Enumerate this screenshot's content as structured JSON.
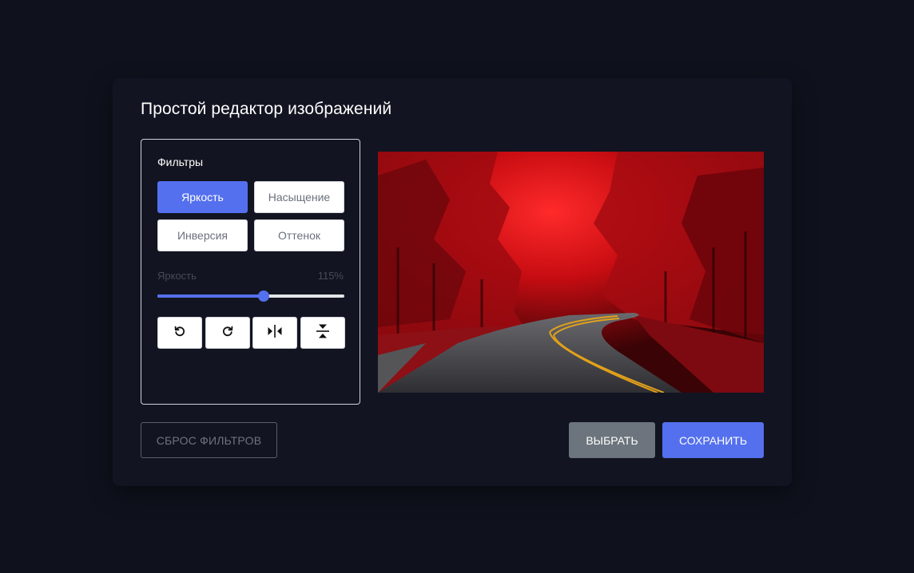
{
  "app": {
    "title": "Простой редактор изображений"
  },
  "filters": {
    "label": "Фильтры",
    "buttons": [
      {
        "label": "Яркость",
        "active": true
      },
      {
        "label": "Насыщение",
        "active": false
      },
      {
        "label": "Инверсия",
        "active": false
      },
      {
        "label": "Оттенок",
        "active": false
      }
    ],
    "slider": {
      "name": "Яркость",
      "value_text": "115%",
      "fraction": 0.57
    }
  },
  "tools": [
    {
      "icon": "rotate-left-icon"
    },
    {
      "icon": "rotate-right-icon"
    },
    {
      "icon": "flip-horizontal-icon"
    },
    {
      "icon": "flip-vertical-icon"
    }
  ],
  "actions": {
    "reset_label": "СБРОС ФИЛЬТРОВ",
    "choose_label": "ВЫБРАТЬ",
    "save_label": "СОХРАНИТЬ"
  },
  "colors": {
    "accent": "#5470ee",
    "secondary": "#6c757d",
    "background": "#0f121d",
    "card": "#121521"
  }
}
